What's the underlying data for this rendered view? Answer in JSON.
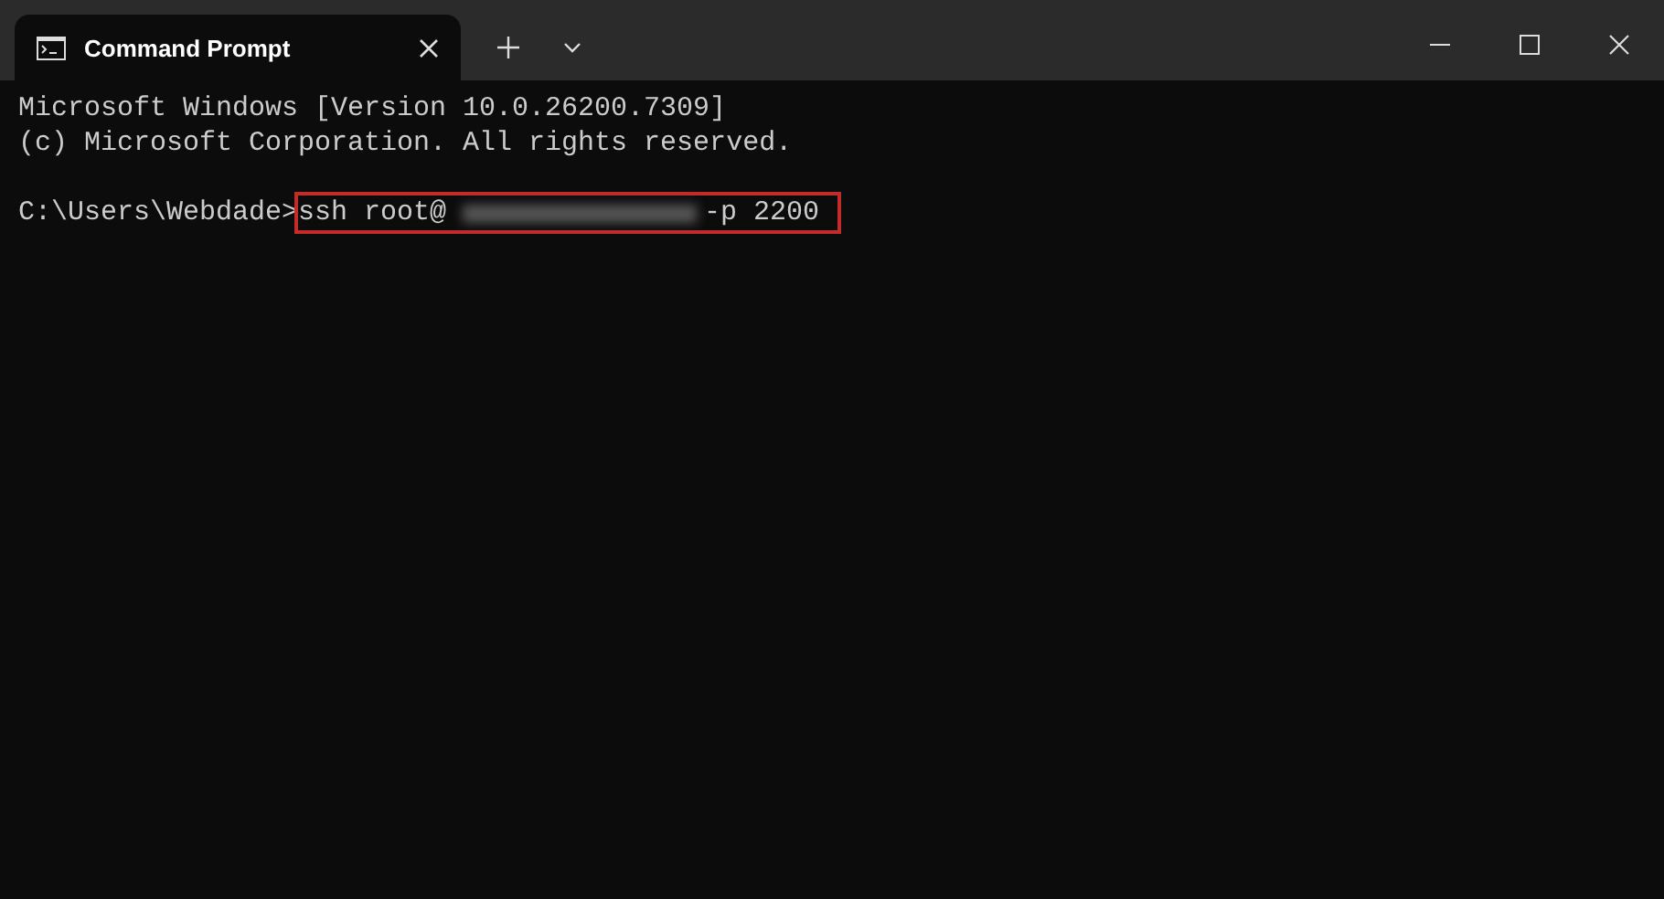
{
  "tabs": [
    {
      "title": "Command Prompt",
      "selected": true
    }
  ],
  "output_lines": [
    "Microsoft Windows [Version 10.0.26200.7309]",
    "(c) Microsoft Corporation. All rights reserved."
  ],
  "prompt": {
    "path": "C:\\Users\\Webdade>",
    "command_before": "ssh root@",
    "command_after": "-p 2200",
    "redacted": true,
    "highlighted": true
  }
}
